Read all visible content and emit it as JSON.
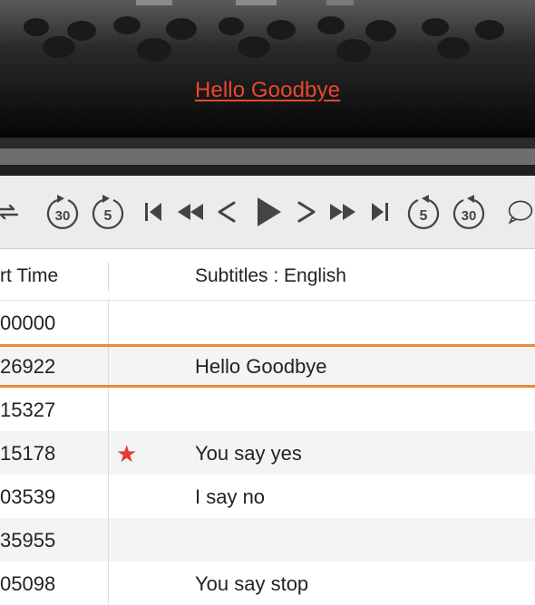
{
  "video": {
    "subtitle_text": "Hello Goodbye",
    "subtitle_color": "#e8472f"
  },
  "controls": {
    "buttons": [
      {
        "name": "loop-icon",
        "label": ""
      },
      {
        "name": "rewind-30-icon",
        "label": "30"
      },
      {
        "name": "rewind-5-icon",
        "label": "5"
      },
      {
        "name": "skip-to-start-icon",
        "label": ""
      },
      {
        "name": "fast-rewind-icon",
        "label": ""
      },
      {
        "name": "previous-icon",
        "label": ""
      },
      {
        "name": "play-icon",
        "label": ""
      },
      {
        "name": "next-icon",
        "label": ""
      },
      {
        "name": "fast-forward-icon",
        "label": ""
      },
      {
        "name": "skip-to-end-icon",
        "label": ""
      },
      {
        "name": "forward-5-icon",
        "label": "5"
      },
      {
        "name": "forward-30-icon",
        "label": "30"
      },
      {
        "name": "speech-bubble-icon",
        "label": ""
      }
    ]
  },
  "table": {
    "header_time": "rt Time",
    "header_subtitles": "Subtitles : English",
    "accent_color": "#ec8a35",
    "star_color": "#e63b2e",
    "rows": [
      {
        "time": "00000",
        "text": "",
        "starred": false
      },
      {
        "time": "26922",
        "text": "Hello Goodbye",
        "starred": false,
        "selected": true
      },
      {
        "time": "15327",
        "text": "",
        "starred": false
      },
      {
        "time": "15178",
        "text": "You say yes",
        "starred": true
      },
      {
        "time": "03539",
        "text": "I say no",
        "starred": false
      },
      {
        "time": "35955",
        "text": "",
        "starred": false
      },
      {
        "time": "05098",
        "text": "You say stop",
        "starred": false
      }
    ]
  }
}
